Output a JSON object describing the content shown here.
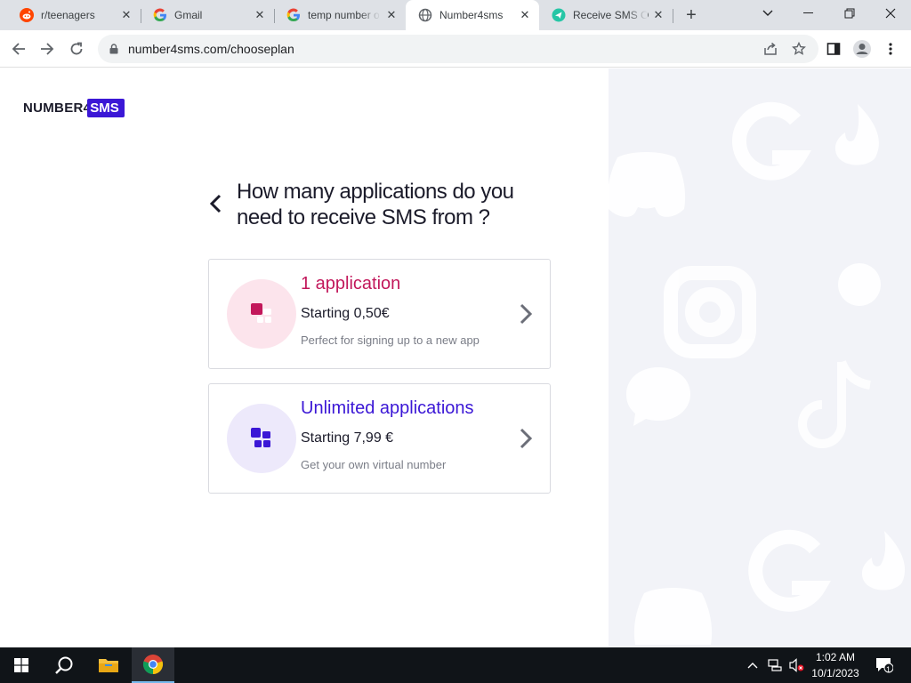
{
  "browser": {
    "tabs": [
      {
        "title": "r/teenagers",
        "icon": "reddit-icon",
        "active": false
      },
      {
        "title": "Gmail",
        "icon": "google-icon",
        "active": false
      },
      {
        "title": "temp number o",
        "icon": "google-icon",
        "active": false
      },
      {
        "title": "Number4sms",
        "icon": "globe-icon",
        "active": true
      },
      {
        "title": "Receive SMS O",
        "icon": "receive-sms-icon",
        "active": false
      }
    ],
    "new_tab_label": "+",
    "url": "number4sms.com/chooseplan"
  },
  "page": {
    "logo": {
      "word": "NUMBER4",
      "badge": "SMS"
    },
    "heading_line1": "How many applications do you",
    "heading_line2": "need to receive SMS from ?",
    "plans": [
      {
        "title": "1 application",
        "price": "Starting 0,50€",
        "desc": "Perfect for signing up to a new app",
        "accent": "#c2185b",
        "circle": "#fce4ec"
      },
      {
        "title": "Unlimited applications",
        "price": "Starting 7,99 €",
        "desc": "Get your own virtual number",
        "accent": "#3b17d6",
        "circle": "#ede9fb"
      }
    ],
    "brand_color": "#3b17d6"
  },
  "taskbar": {
    "time": "1:02 AM",
    "date": "10/1/2023",
    "notification_count": "1"
  }
}
